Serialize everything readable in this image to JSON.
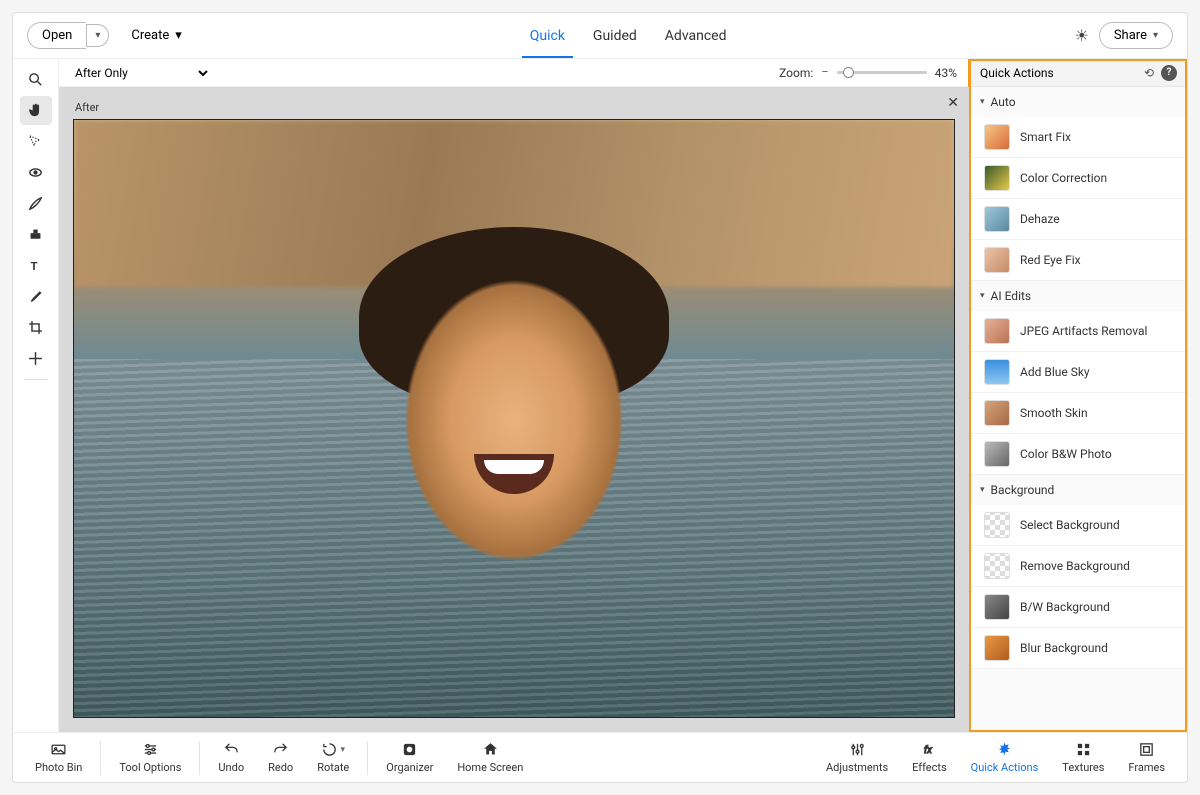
{
  "topbar": {
    "open_label": "Open",
    "create_label": "Create",
    "share_label": "Share",
    "tabs": [
      {
        "label": "Quick",
        "active": true
      },
      {
        "label": "Guided",
        "active": false
      },
      {
        "label": "Advanced",
        "active": false
      }
    ]
  },
  "viewbar": {
    "mode": "After Only",
    "zoom_label": "Zoom:",
    "zoom_value": "43%"
  },
  "canvas": {
    "badge": "After"
  },
  "right_panel": {
    "title": "Quick Actions",
    "groups": [
      {
        "title": "Auto",
        "items": [
          {
            "label": "Smart Fix"
          },
          {
            "label": "Color Correction"
          },
          {
            "label": "Dehaze"
          },
          {
            "label": "Red Eye Fix"
          }
        ]
      },
      {
        "title": "AI Edits",
        "items": [
          {
            "label": "JPEG Artifacts Removal"
          },
          {
            "label": "Add Blue Sky"
          },
          {
            "label": "Smooth Skin"
          },
          {
            "label": "Color B&W Photo"
          }
        ]
      },
      {
        "title": "Background",
        "items": [
          {
            "label": "Select Background"
          },
          {
            "label": "Remove Background"
          },
          {
            "label": "B/W Background"
          },
          {
            "label": "Blur Background"
          }
        ]
      }
    ]
  },
  "bottombar": {
    "items_left": [
      {
        "label": "Photo Bin"
      },
      {
        "label": "Tool Options"
      },
      {
        "label": "Undo"
      },
      {
        "label": "Redo"
      },
      {
        "label": "Rotate"
      },
      {
        "label": "Organizer"
      },
      {
        "label": "Home Screen"
      }
    ],
    "items_right": [
      {
        "label": "Adjustments"
      },
      {
        "label": "Effects"
      },
      {
        "label": "Quick Actions",
        "active": true
      },
      {
        "label": "Textures"
      },
      {
        "label": "Frames"
      }
    ]
  },
  "left_tools": [
    "zoom",
    "hand",
    "magic-wand",
    "red-eye",
    "brush",
    "clone",
    "text",
    "eyedropper",
    "crop",
    "add"
  ],
  "colors": {
    "accent": "#1473e6",
    "highlight_outline": "#f29b1e"
  }
}
